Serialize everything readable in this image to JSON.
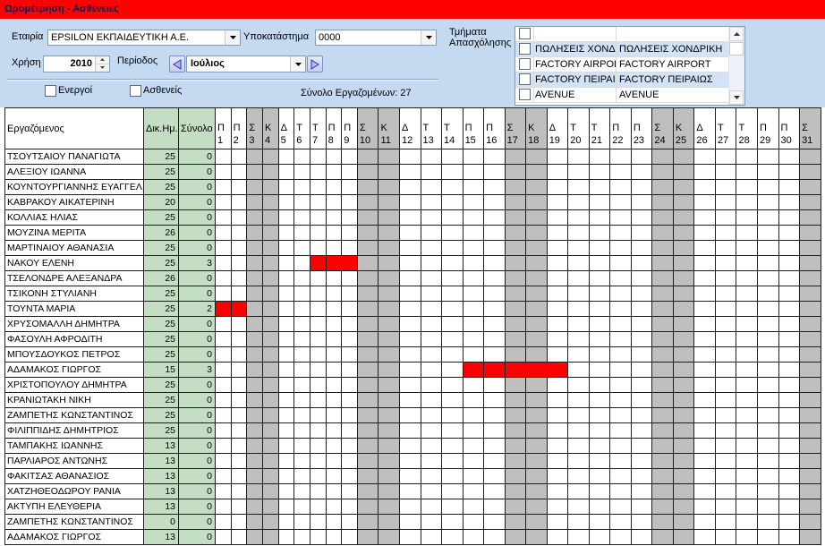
{
  "window": {
    "title": "Ωρομέτρηση - Ασθένειες"
  },
  "filters": {
    "company_label": "Εταιρία",
    "company_value": "EPSILON ΕΚΠΑΙΔΕΥΤΙΚΗ Α.Ε.",
    "branch_label": "Υποκατάστημα",
    "branch_value": "0000",
    "year_label": "Χρήση",
    "year_value": "2010",
    "period_label": "Περίοδος",
    "period_value": "Ιούλιος",
    "active_label": "Ενεργοί",
    "active_checked": false,
    "sick_label": "Ασθενείς",
    "sick_checked": false,
    "total_employees": "Σύνολο Εργαζομένων: 27"
  },
  "departments": {
    "label_line1": "Τμήματα",
    "label_line2": "Απασχόλησης",
    "items": [
      {
        "code": "",
        "description": "",
        "checked": false
      },
      {
        "code": "ΠΩΛΗΣΕΙΣ ΧΟΝΔΡ",
        "description": "ΠΩΛΗΣΕΙΣ ΧΟΝΔΡΙΚΗ",
        "checked": false
      },
      {
        "code": "FACTORY AIRPOR",
        "description": "FACTORY AIRPORT",
        "checked": false
      },
      {
        "code": "FACTORY ΠΕΙΡΑΙΩ",
        "description": "FACTORY ΠΕΙΡΑΙΩΣ",
        "checked": false
      },
      {
        "code": "AVENUE",
        "description": "AVENUE",
        "checked": false
      }
    ]
  },
  "grid": {
    "columns": {
      "employee": "Εργαζόμενος",
      "contract_days": "Δικ.Ημ.",
      "total": "Σύνολο"
    },
    "days": [
      {
        "letter": "Π",
        "day": 1,
        "weekend": false
      },
      {
        "letter": "Π",
        "day": 2,
        "weekend": false
      },
      {
        "letter": "Σ",
        "day": 3,
        "weekend": true
      },
      {
        "letter": "Κ",
        "day": 4,
        "weekend": true
      },
      {
        "letter": "Δ",
        "day": 5,
        "weekend": false
      },
      {
        "letter": "Τ",
        "day": 6,
        "weekend": false
      },
      {
        "letter": "Τ",
        "day": 7,
        "weekend": false
      },
      {
        "letter": "Π",
        "day": 8,
        "weekend": false
      },
      {
        "letter": "Π",
        "day": 9,
        "weekend": false
      },
      {
        "letter": "Σ",
        "day": 10,
        "weekend": true
      },
      {
        "letter": "Κ",
        "day": 11,
        "weekend": true
      },
      {
        "letter": "Δ",
        "day": 12,
        "weekend": false
      },
      {
        "letter": "Τ",
        "day": 13,
        "weekend": false
      },
      {
        "letter": "Τ",
        "day": 14,
        "weekend": false
      },
      {
        "letter": "Π",
        "day": 15,
        "weekend": false
      },
      {
        "letter": "Π",
        "day": 16,
        "weekend": false
      },
      {
        "letter": "Σ",
        "day": 17,
        "weekend": true
      },
      {
        "letter": "Κ",
        "day": 18,
        "weekend": true
      },
      {
        "letter": "Δ",
        "day": 19,
        "weekend": false
      },
      {
        "letter": "Τ",
        "day": 20,
        "weekend": false
      },
      {
        "letter": "Τ",
        "day": 21,
        "weekend": false
      },
      {
        "letter": "Π",
        "day": 22,
        "weekend": false
      },
      {
        "letter": "Π",
        "day": 23,
        "weekend": false
      },
      {
        "letter": "Σ",
        "day": 24,
        "weekend": true
      },
      {
        "letter": "Κ",
        "day": 25,
        "weekend": true
      },
      {
        "letter": "Δ",
        "day": 26,
        "weekend": false
      },
      {
        "letter": "Τ",
        "day": 27,
        "weekend": false
      },
      {
        "letter": "Τ",
        "day": 28,
        "weekend": false
      },
      {
        "letter": "Π",
        "day": 29,
        "weekend": false
      },
      {
        "letter": "Π",
        "day": 30,
        "weekend": false
      },
      {
        "letter": "Σ",
        "day": 31,
        "weekend": true
      }
    ],
    "rows": [
      {
        "name": "ΤΣΟΥΤΣΑΙΟΥ ΠΑΝΑΓΙΩΤΑ",
        "contract_days": 25,
        "total": 0,
        "absences": []
      },
      {
        "name": "ΑΛΕΞΙΟΥ ΙΩΑΝΝΑ",
        "contract_days": 25,
        "total": 0,
        "absences": []
      },
      {
        "name": "ΚΟΥΝΤΟΥΡΓΙΑΝΝΗΣ ΕΥΑΓΓΕΛ",
        "contract_days": 25,
        "total": 0,
        "absences": []
      },
      {
        "name": "ΚΑΒΡΑΚΟΥ ΑΙΚΑΤΕΡΙΝΗ",
        "contract_days": 20,
        "total": 0,
        "absences": []
      },
      {
        "name": "ΚΟΛΛΙΑΣ ΗΛΙΑΣ",
        "contract_days": 25,
        "total": 0,
        "absences": []
      },
      {
        "name": "ΜΟΥΖΙΝΑ ΜΕΡΙΤΑ",
        "contract_days": 26,
        "total": 0,
        "absences": []
      },
      {
        "name": "ΜΑΡΤΙΝΑΙΟΥ ΑΘΑΝΑΣΙΑ",
        "contract_days": 25,
        "total": 0,
        "absences": []
      },
      {
        "name": "ΝΑΚΟΥ ΕΛΕΝΗ",
        "contract_days": 25,
        "total": 3,
        "absences": [
          7,
          8,
          9
        ]
      },
      {
        "name": "ΤΣΕΛΟΝΔΡΕ ΑΛΕΞΑΝΔΡΑ",
        "contract_days": 26,
        "total": 0,
        "absences": []
      },
      {
        "name": "ΤΣΙΚΟΝΗ ΣΤΥΛΙΑΝΗ",
        "contract_days": 25,
        "total": 0,
        "absences": []
      },
      {
        "name": "ΤΟΥΝΤΑ ΜΑΡΙΑ",
        "contract_days": 25,
        "total": 2,
        "absences": [
          1,
          2
        ]
      },
      {
        "name": "ΧΡΥΣΟΜΑΛΛΗ ΔΗΜΗΤΡΑ",
        "contract_days": 25,
        "total": 0,
        "absences": []
      },
      {
        "name": "ΦΑΣΟΥΛΗ ΑΦΡΟΔΙΤΗ",
        "contract_days": 25,
        "total": 0,
        "absences": []
      },
      {
        "name": "ΜΠΟΥΣΔΟΥΚΟΣ ΠΕΤΡΟΣ",
        "contract_days": 25,
        "total": 0,
        "absences": []
      },
      {
        "name": "ΑΔΑΜΑΚΟΣ ΓΙΩΡΓΟΣ",
        "contract_days": 15,
        "total": 3,
        "absences": [
          15,
          16,
          17,
          18,
          19
        ]
      },
      {
        "name": "ΧΡΙΣΤΟΠΟΥΛΟΥ ΔΗΜΗΤΡΑ",
        "contract_days": 25,
        "total": 0,
        "absences": []
      },
      {
        "name": "ΚΡΑΝΙΩΤΑΚΗ ΝΙΚΗ",
        "contract_days": 25,
        "total": 0,
        "absences": []
      },
      {
        "name": "ΖΑΜΠΕΤΗΣ ΚΩΝΣΤΑΝΤΙΝΟΣ",
        "contract_days": 25,
        "total": 0,
        "absences": []
      },
      {
        "name": "ΦΙΛΙΠΠΙΔΗΣ ΔΗΜΗΤΡΙΟΣ",
        "contract_days": 25,
        "total": 0,
        "absences": []
      },
      {
        "name": "ΤΑΜΠΑΚΗΣ ΙΩΑΝΝΗΣ",
        "contract_days": 13,
        "total": 0,
        "absences": []
      },
      {
        "name": "ΠΑΡΛΙΑΡΟΣ ΑΝΤΩΝΗΣ",
        "contract_days": 13,
        "total": 0,
        "absences": []
      },
      {
        "name": "ΦΑΚΙΤΣΑΣ ΑΘΑΝΑΣΙΟΣ",
        "contract_days": 13,
        "total": 0,
        "absences": []
      },
      {
        "name": "ΧΑΤΖΗΘΕΟΔΩΡΟΥ ΡΑΝΙΑ",
        "contract_days": 13,
        "total": 0,
        "absences": []
      },
      {
        "name": "ΑΚΤΥΠΗ ΕΛΕΥΘΕΡΙΑ",
        "contract_days": 13,
        "total": 0,
        "absences": []
      },
      {
        "name": "ΖΑΜΠΕΤΗΣ ΚΩΝΣΤΑΝΤΙΝΟΣ",
        "contract_days": 0,
        "total": 0,
        "absences": []
      },
      {
        "name": "ΑΔΑΜΑΚΟΣ ΓΙΩΡΓΟΣ",
        "contract_days": 13,
        "total": 0,
        "absences": []
      }
    ]
  },
  "colors": {
    "title_bar": "#FF0000",
    "panel": "#C5D9F1",
    "absence": "#FF0000",
    "weekend": "#BFBFBF",
    "totals_columns": "#C4DEC4",
    "list_alt_row": "#D3E3F6"
  }
}
